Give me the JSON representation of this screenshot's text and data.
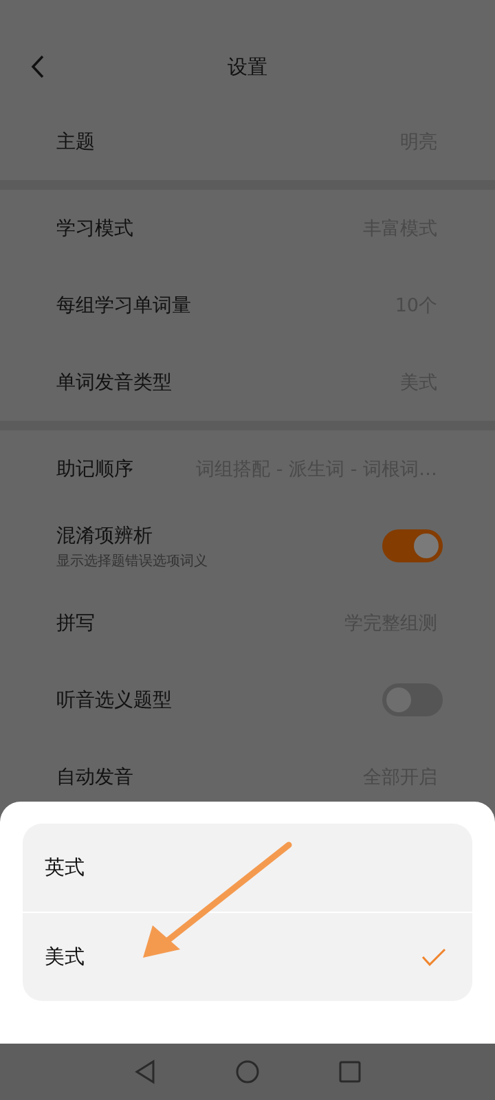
{
  "header": {
    "title": "设置"
  },
  "groups": [
    {
      "rows": [
        {
          "kind": "value",
          "label": "主题",
          "value": "明亮"
        }
      ]
    },
    {
      "rows": [
        {
          "kind": "value",
          "label": "学习模式",
          "value": "丰富模式"
        },
        {
          "kind": "value",
          "label": "每组学习单词量",
          "value": "10个"
        },
        {
          "kind": "value",
          "label": "单词发音类型",
          "value": "美式"
        }
      ]
    },
    {
      "rows": [
        {
          "kind": "value",
          "label": "助记顺序",
          "value": "词组搭配 - 派生词 - 词根词…"
        },
        {
          "kind": "toggle",
          "label": "混淆项辨析",
          "sublabel": "显示选择题错误选项词义",
          "on": true
        },
        {
          "kind": "value",
          "label": "拼写",
          "value": "学完整组测"
        },
        {
          "kind": "toggle",
          "label": "听音选义题型",
          "on": false
        },
        {
          "kind": "value",
          "label": "自动发音",
          "value": "全部开启"
        }
      ]
    }
  ],
  "sheet": {
    "options": [
      {
        "label": "英式",
        "selected": false
      },
      {
        "label": "美式",
        "selected": true
      }
    ]
  }
}
